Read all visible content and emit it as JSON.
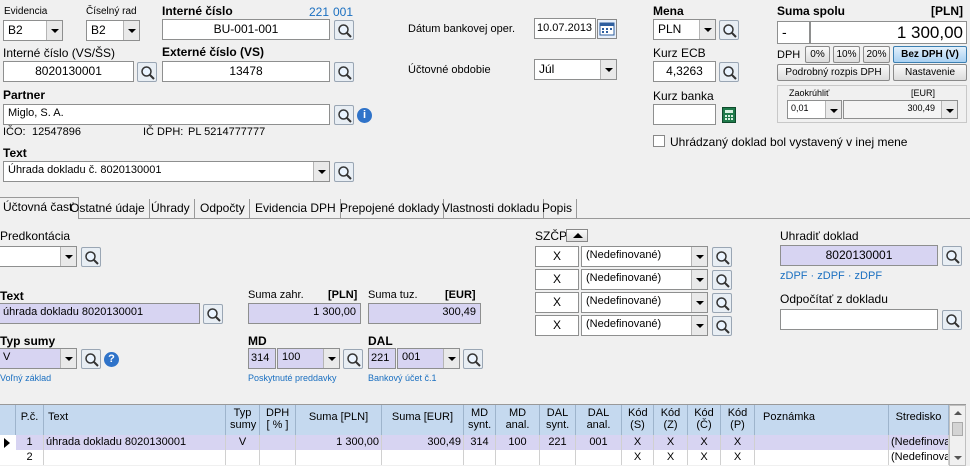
{
  "header": {
    "evidencia_label": "Evidencia",
    "evidencia_value": "B2",
    "ciselny_rad_label": "Číselný rad",
    "ciselny_rad_value": "B2",
    "interne_cislo_label": "Interné číslo",
    "interne_cislo_counter_a": "221",
    "interne_cislo_counter_b": "001",
    "interne_cislo_value": "BU-001-001",
    "interne_cislo_vs_label": "Interné číslo (VS/ŠS)",
    "interne_cislo_vs_value": "8020130001",
    "externe_cislo_label": "Externé číslo (VS)",
    "externe_cislo_value": "13478",
    "datum_label": "Dátum bankovej oper.",
    "datum_value": "10.07.2013",
    "uctovne_obdobie_label": "Účtovné obdobie",
    "uctovne_obdobie_value": "Júl",
    "partner_label": "Partner",
    "partner_value": "Miglo, S. A.",
    "ico_label": "IČO:",
    "ico_value": "12547896",
    "ic_dph_label": "IČ DPH:",
    "ic_dph_value": "PL 5214777777",
    "text_label": "Text",
    "text_value": "Úhrada dokladu č. 8020130001"
  },
  "currency": {
    "mena_label": "Mena",
    "mena_value": "PLN",
    "kurz_ecb_label": "Kurz ECB",
    "kurz_ecb_value": "4,3263",
    "kurz_banka_label": "Kurz banka",
    "kurz_banka_value": "",
    "foreign_doc_checkbox_label": "Uhrádzaný doklad bol vystavený v inej mene"
  },
  "summary": {
    "suma_spolu_label": "Suma spolu",
    "suma_currency": "[PLN]",
    "sign": "-",
    "suma_value": "1 300,00",
    "dph_label": "DPH",
    "dph_0": "0%",
    "dph_10": "10%",
    "dph_20": "20%",
    "bez_dph": "Bez DPH (V)",
    "podrobny_rozpis": "Podrobný rozpis DPH",
    "nastavenie": "Nastavenie",
    "zaokruhlit_label": "Zaokrúhliť",
    "zaokruhlit_currency": "[EUR]",
    "zaokruhlit_value": "0,01",
    "zaokruhlit_amount": "300,49"
  },
  "tabs": [
    {
      "label": "Účtovná časť"
    },
    {
      "label": "Ostatné údaje"
    },
    {
      "label": "Úhrady"
    },
    {
      "label": "Odpočty"
    },
    {
      "label": "Evidencia DPH"
    },
    {
      "label": "Prepojené doklady"
    },
    {
      "label": "Vlastnosti dokladu"
    },
    {
      "label": "Popis"
    }
  ],
  "detail": {
    "predkontacia_label": "Predkontácia",
    "predkontacia_value": "",
    "text_label": "Text",
    "text_value": "úhrada dokladu 8020130001",
    "suma_zahr_label": "Suma zahr.",
    "suma_zahr_currency": "[PLN]",
    "suma_zahr_value": "1 300,00",
    "suma_tuz_label": "Suma tuz.",
    "suma_tuz_currency": "[EUR]",
    "suma_tuz_value": "300,49",
    "typ_sumy_label": "Typ sumy",
    "typ_sumy_value": "V",
    "typ_sumy_desc": "Voľný základ",
    "md_label": "MD",
    "md_synt": "314",
    "md_anal": "100",
    "md_desc": "Poskytnuté preddavky",
    "dal_label": "DAL",
    "dal_synt": "221",
    "dal_anal": "001",
    "dal_desc": "Bankový účet č.1",
    "szcp_label": "SZČP",
    "szcp_rows": [
      {
        "x": "X",
        "value": "(Nedefinované)"
      },
      {
        "x": "X",
        "value": "(Nedefinované)"
      },
      {
        "x": "X",
        "value": "(Nedefinované)"
      },
      {
        "x": "X",
        "value": "(Nedefinované)"
      }
    ],
    "uhradit_label": "Uhradiť doklad",
    "uhradit_value": "8020130001",
    "zdpf_links": "zDPF · zDPF · zDPF",
    "odpocitat_label": "Odpočítať z dokladu",
    "odpocitat_value": ""
  },
  "table": {
    "columns": [
      "P.č.",
      "Text",
      "Typ sumy",
      "DPH [ % ]",
      "Suma [PLN]",
      "Suma [EUR]",
      "MD synt.",
      "MD anal.",
      "DAL synt.",
      "DAL anal.",
      "Kód (S)",
      "Kód (Z)",
      "Kód (Č)",
      "Kód (P)",
      "Poznámka",
      "Stredisko"
    ],
    "rows": [
      [
        "1",
        "úhrada dokladu 8020130001",
        "V",
        "",
        "1 300,00",
        "300,49",
        "314",
        "100",
        "221",
        "001",
        "X",
        "X",
        "X",
        "X",
        "",
        "(Nedefinova"
      ],
      [
        "2",
        "",
        "",
        "",
        "",
        "",
        "",
        "",
        "",
        "",
        "X",
        "X",
        "X",
        "X",
        "",
        "(Nedefinova"
      ]
    ]
  },
  "colors": {
    "accent_blue": "#1a6fc0",
    "selected_row": "#d7d4f2",
    "grid_header": "#c5d9ef"
  }
}
